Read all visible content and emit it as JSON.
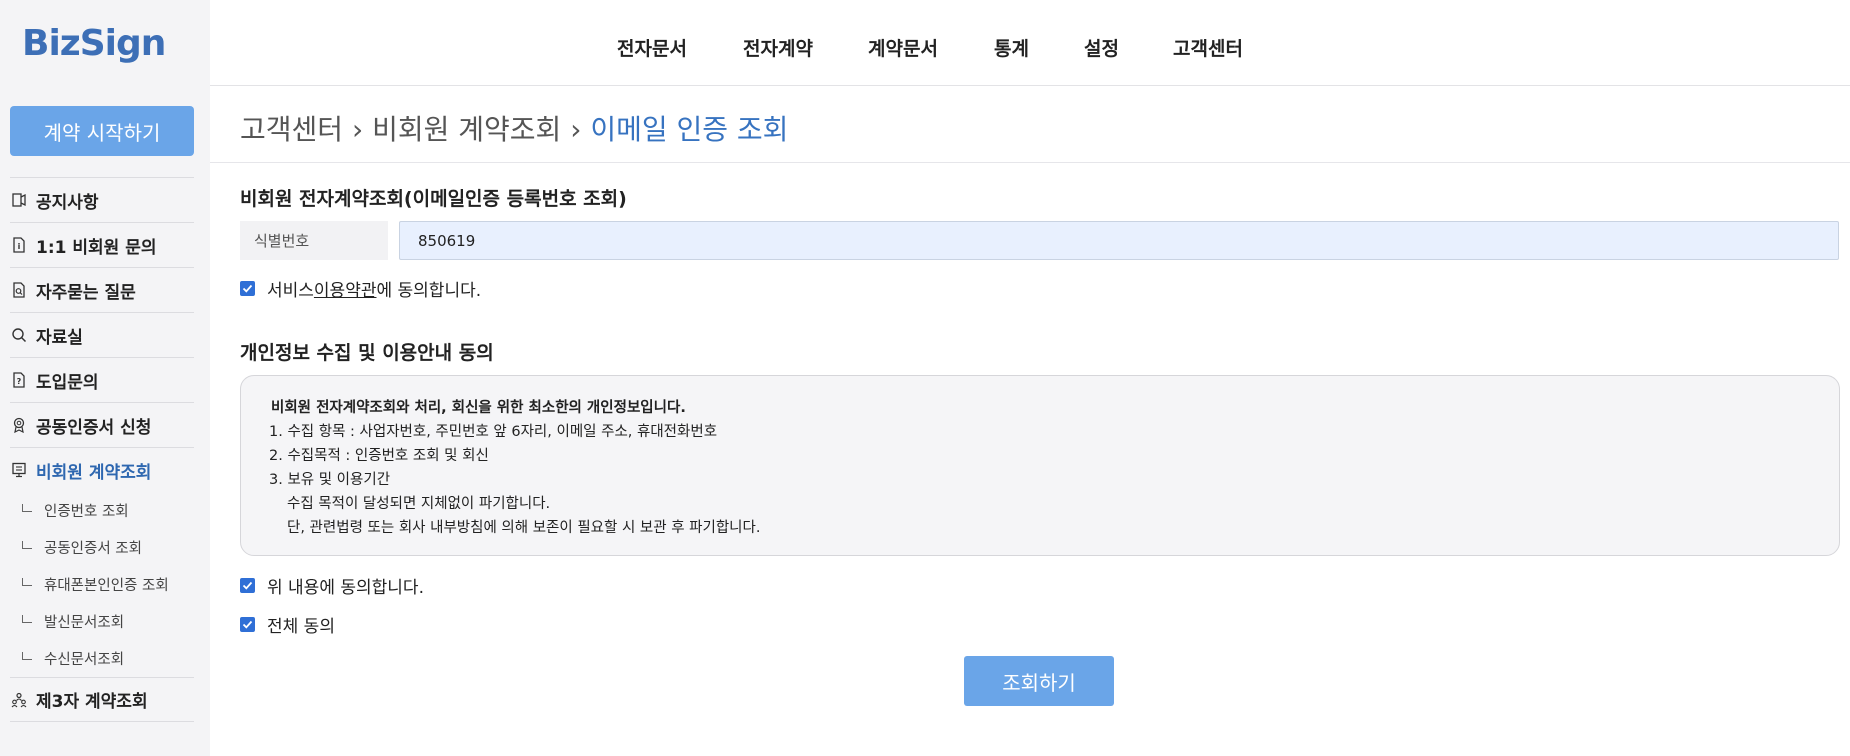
{
  "logo": "BizSign",
  "sidebar": {
    "start_button": "계약 시작하기",
    "items": [
      {
        "label": "공지사항",
        "icon": "notice-icon"
      },
      {
        "label": "1:1 비회원 문의",
        "icon": "inquiry-icon"
      },
      {
        "label": "자주묻는 질문",
        "icon": "faq-icon"
      },
      {
        "label": "자료실",
        "icon": "search-icon"
      },
      {
        "label": "도입문의",
        "icon": "document-question-icon"
      },
      {
        "label": "공동인증서 신청",
        "icon": "certificate-icon"
      },
      {
        "label": "비회원 계약조회",
        "icon": "monitor-icon"
      },
      {
        "label": "제3자 계약조회",
        "icon": "people-icon"
      }
    ],
    "subitems": [
      "인증번호 조회",
      "공동인증서 조회",
      "휴대폰본인인증 조회",
      "발신문서조회",
      "수신문서조회"
    ]
  },
  "topnav": [
    "전자문서",
    "전자계약",
    "계약문서",
    "통계",
    "설정",
    "고객센터"
  ],
  "breadcrumb": {
    "part1": "고객센터",
    "sep": "›",
    "part2": "비회원 계약조회",
    "current": "이메일 인증 조회"
  },
  "form": {
    "title": "비회원 전자계약조회(이메일인증 등록번호 조회)",
    "id_label": "식별번호",
    "id_value": "850619",
    "terms_prefix": "서비스 ",
    "terms_link": "이용약관",
    "terms_suffix": "에 동의합니다."
  },
  "privacy": {
    "title": "개인정보 수집 및 이용안내 동의",
    "box_title": "비회원 전자계약조회와 처리, 회신을 위한 최소한의 개인정보입니다.",
    "line1": "1. 수집 항목 : 사업자번호, 주민번호 앞 6자리, 이메일 주소, 휴대전화번호",
    "line2": "2. 수집목적 : 인증번호 조회 및 회신",
    "line3": "3. 보유 및 이용기간",
    "line4": "수집 목적이 달성되면 지체없이 파기합니다.",
    "line5": "단, 관련법령 또는 회사 내부방침에 의해 보존이 필요할 시 보관 후 파기합니다.",
    "agree_label": "위 내용에 동의합니다.",
    "agree_all_label": "전체 동의"
  },
  "search_button": "조회하기",
  "colors": {
    "accent": "#6aa5e8",
    "active": "#2e67b0",
    "checkbox": "#2f6fd6"
  }
}
